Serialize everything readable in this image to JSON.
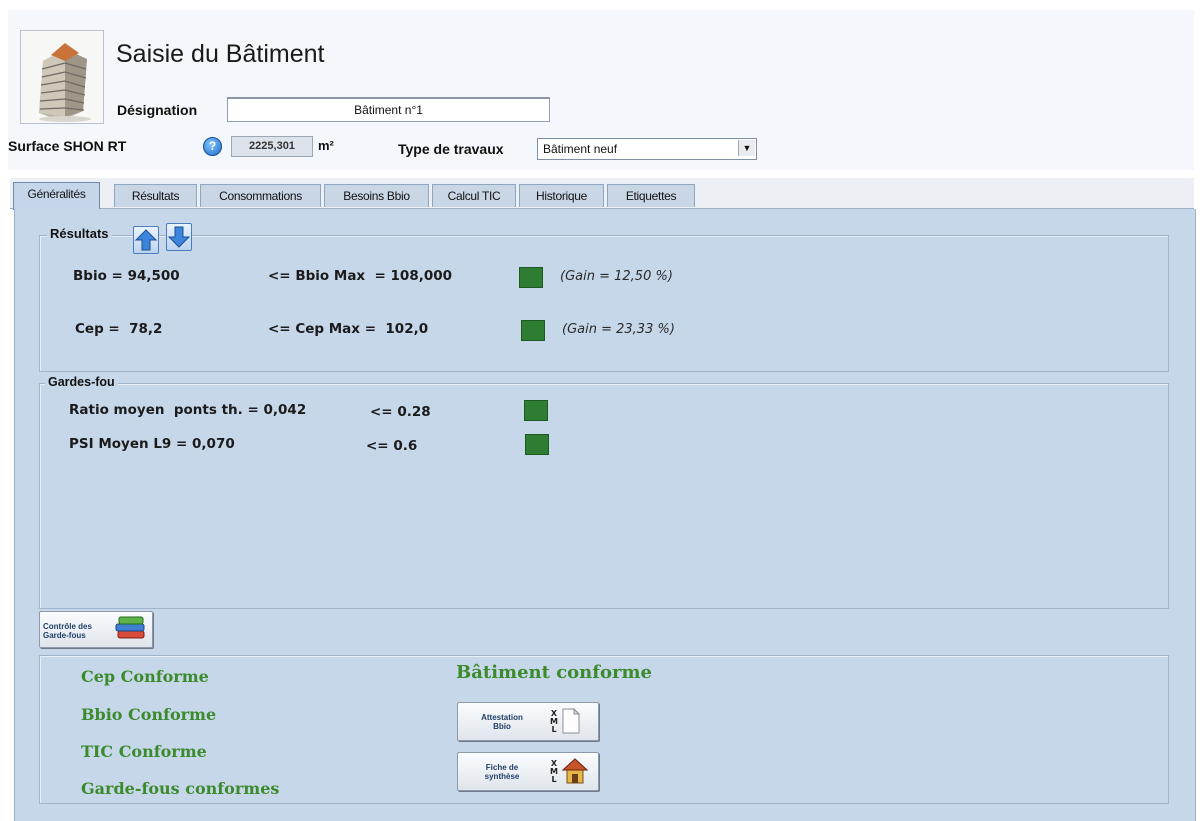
{
  "header": {
    "title": "Saisie du Bâtiment",
    "designation_label": "Désignation",
    "designation_value": "Bâtiment n°1",
    "surface_label": "Surface SHON RT",
    "help_icon": "?",
    "surface_value": "2225,301",
    "surface_unit": "m²",
    "type_label": "Type de travaux",
    "type_value": "Bâtiment neuf"
  },
  "tabs": [
    {
      "label": "Généralités",
      "active": true
    },
    {
      "label": "Résultats"
    },
    {
      "label": "Consommations"
    },
    {
      "label": "Besoins Bbio"
    },
    {
      "label": "Calcul TIC"
    },
    {
      "label": "Historique"
    },
    {
      "label": "Etiquettes"
    }
  ],
  "results": {
    "title": "Résultats",
    "rows": [
      {
        "value": "Bbio = 94,500",
        "max": "<= Bbio Max  = 108,000",
        "gain": "(Gain = 12,50 %)",
        "status_color": "#2e7d32"
      },
      {
        "value": "Cep =  78,2",
        "max": "<= Cep Max =  102,0",
        "gain": "(Gain = 23,33 %)",
        "status_color": "#2e7d32"
      }
    ]
  },
  "gardes_fou": {
    "title": "Gardes-fou",
    "rows": [
      {
        "label": "Ratio moyen  ponts th. = 0,042",
        "limit": "<= 0.28",
        "status_color": "#2e7d32"
      },
      {
        "label": "PSI Moyen L9 = 0,070",
        "limit": "<= 0.6",
        "status_color": "#2e7d32"
      }
    ]
  },
  "controle_button": {
    "line1": "Contrôle des",
    "line2": "Garde-fous"
  },
  "conformity": {
    "items": [
      "Cep Conforme",
      "Bbio Conforme",
      "TIC Conforme",
      "Garde-fous conformes"
    ],
    "summary": "Bâtiment conforme"
  },
  "buttons": {
    "attestation": {
      "line1": "Attestation",
      "line2": "Bbio",
      "xml": [
        "X",
        "M",
        "L"
      ]
    },
    "fiche": {
      "line1": "Fiche de",
      "line2": "synthèse",
      "xml": [
        "X",
        "M",
        "L"
      ]
    }
  },
  "colors": {
    "status_ok": "#2e7d32",
    "conform_text": "#3b8a2c",
    "panel_bg": "#c7d7ea"
  },
  "icons": [
    "building-icon",
    "help-icon",
    "dropdown-arrow-icon",
    "arrow-up-icon",
    "arrow-down-icon",
    "books-icon",
    "xml-document-icon",
    "house-icon"
  ]
}
